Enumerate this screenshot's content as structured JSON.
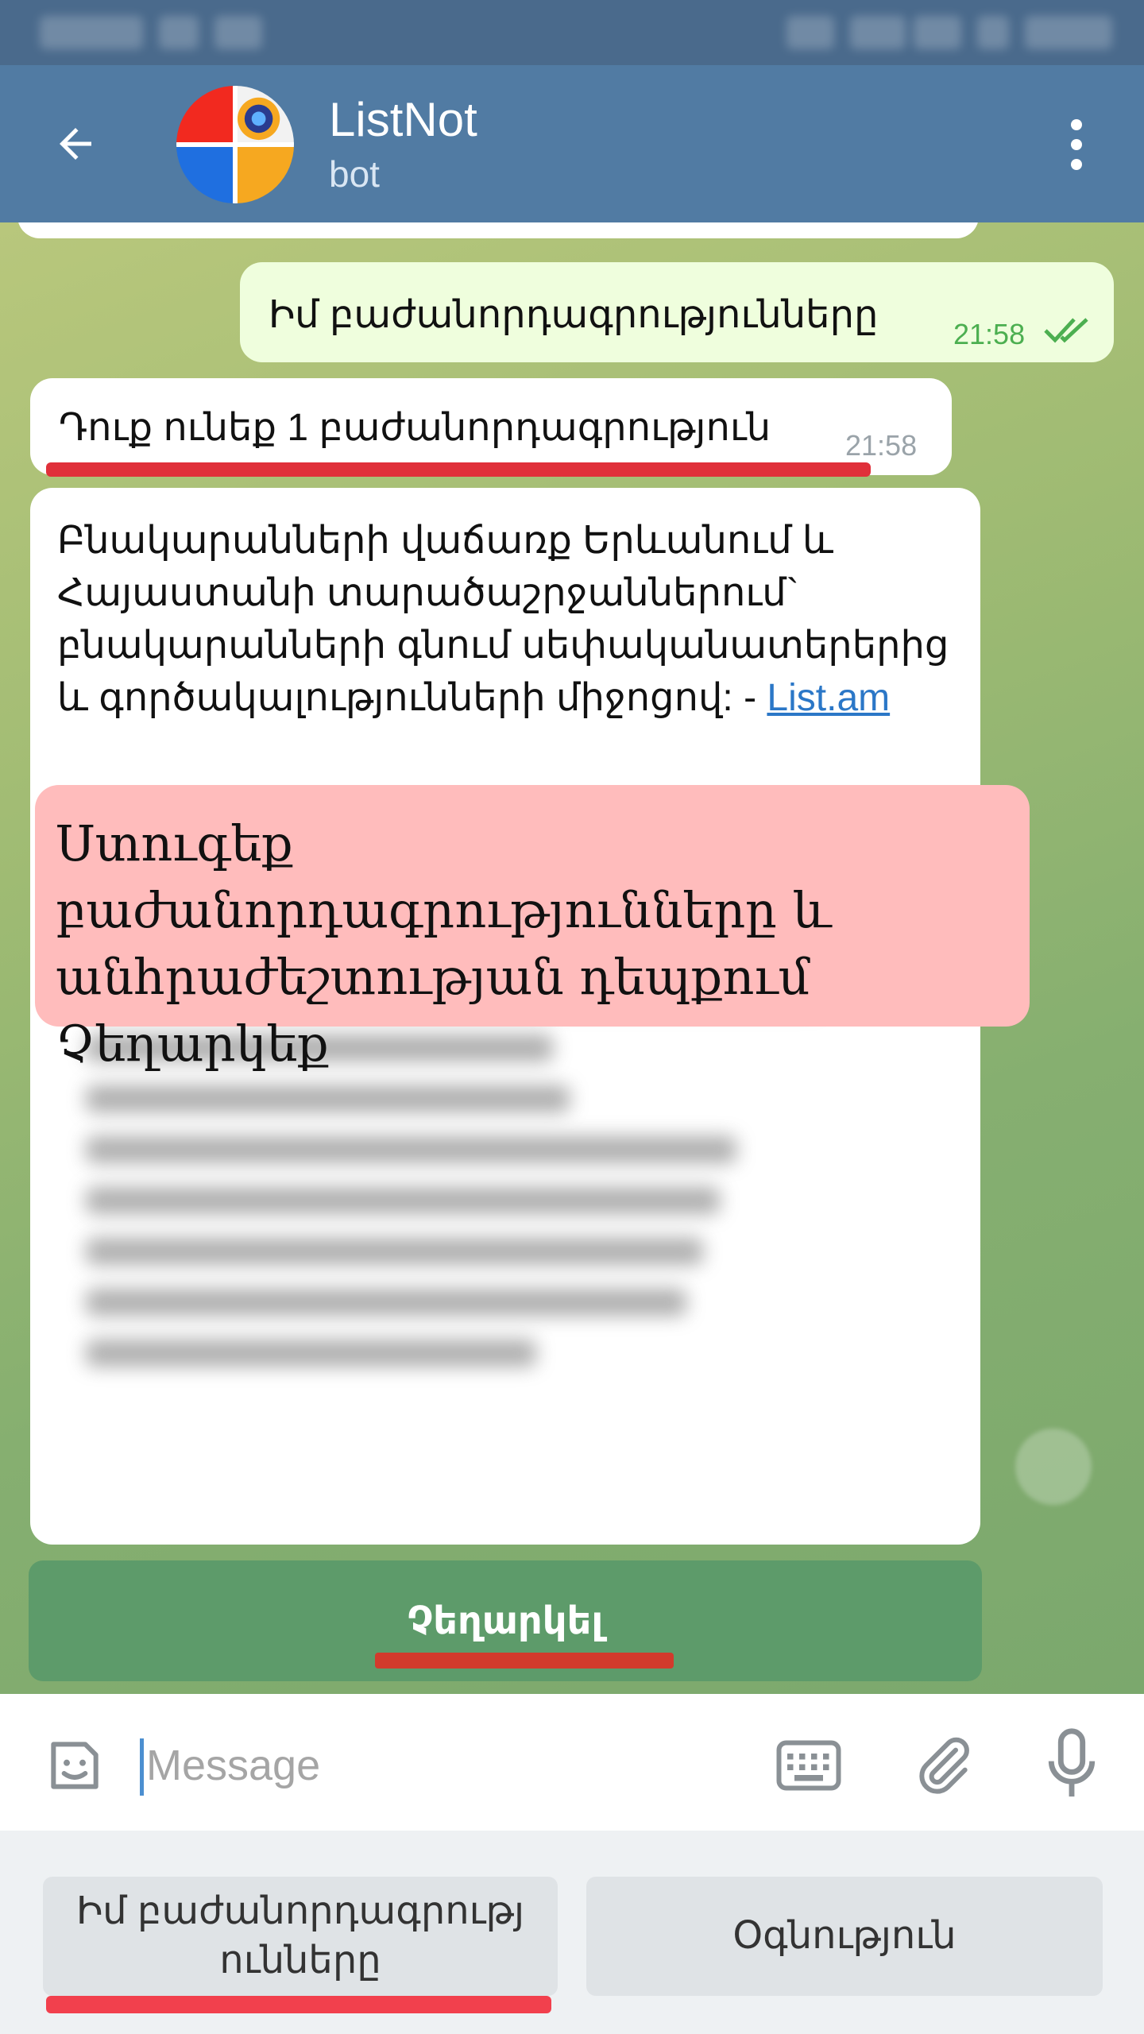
{
  "header": {
    "title": "ListNot",
    "subtitle": "bot",
    "back_icon": "arrow-left-icon",
    "menu_icon": "more-vertical-icon"
  },
  "messages": {
    "outgoing": {
      "text": "Իմ բաժանորդագրությունները",
      "time": "21:58",
      "status_icon": "double-check-icon"
    },
    "incoming": {
      "text": "Դուք ունեք 1 բաժանորդագրություն",
      "time": "21:58"
    },
    "long": {
      "text": "Բնակարանների վաճառք Երևանում և Հայաստանի տարածաշրջաններում` բնակարանների գնում սեփականատերերից և գործակալությունների միջոցով: - ",
      "link": "List.am"
    }
  },
  "overlay_note": {
    "text": "Ստուգեք բաժանորդագրությունները և անհրաժեշտության դեպքում Չեղարկեք"
  },
  "inline_button": {
    "label": "Չեղարկել"
  },
  "input": {
    "placeholder": "Message"
  },
  "reply_keyboard": {
    "buttons": [
      {
        "label": "Իմ բաժանորդագրությ ունները"
      },
      {
        "label": "Օգնություն"
      }
    ]
  },
  "colors": {
    "header": "#517ba3",
    "status_bar": "#4a6a8c",
    "outgoing_bubble": "#effedd",
    "inline_button": "#5d9b6a",
    "overlay_note": "#ffbcbc",
    "underline": "#e0303a"
  }
}
